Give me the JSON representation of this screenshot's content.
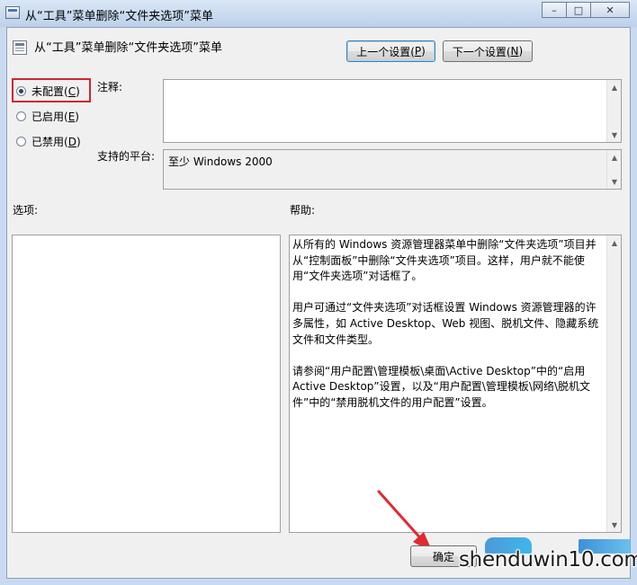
{
  "window": {
    "title": "从“工具”菜单删除“文件夹选项”菜单",
    "minimize_glyph": "–",
    "maximize_glyph": "□",
    "close_glyph": "✕"
  },
  "policy": {
    "title": "从“工具”菜单删除“文件夹选项”菜单",
    "icon": "policy-icon"
  },
  "nav": {
    "prev_label": "上一个设置(",
    "prev_key": "P",
    "next_label": "下一个设置(",
    "next_key": "N",
    "close_paren": ")"
  },
  "state": {
    "options": [
      {
        "label": "未配置(",
        "key": "C",
        "checked": true
      },
      {
        "label": "已启用(",
        "key": "E",
        "checked": false
      },
      {
        "label": "已禁用(",
        "key": "D",
        "checked": false
      }
    ],
    "close_paren": ")"
  },
  "labels": {
    "comment": "注释:",
    "platform": "支持的平台:",
    "options": "选项:",
    "help": "帮助:"
  },
  "platform_value": "至少 Windows 2000",
  "help_paragraphs": [
    "从所有的 Windows 资源管理器菜单中删除“文件夹选项”项目并从“控制面板”中删除“文件夹选项”项目。这样，用户就不能使用“文件夹选项”对话框了。",
    "用户可通过“文件夹选项”对话框设置 Windows 资源管理器的许多属性，如 Active Desktop、Web 视图、脱机文件、隐藏系统文件和文件类型。",
    "请参阅“用户配置\\管理模板\\桌面\\Active Desktop”中的“启用 Active Desktop”设置，以及“用户配置\\管理模板\\网络\\脱机文件”中的“禁用脱机文件的用户配置”设置。"
  ],
  "buttons": {
    "ok": "确定"
  },
  "watermark": {
    "text": "shenduwin10.com"
  },
  "colors": {
    "highlight": "#d0262e",
    "arrow": "#e02a33",
    "default_button_border": "#3c7fb1"
  }
}
